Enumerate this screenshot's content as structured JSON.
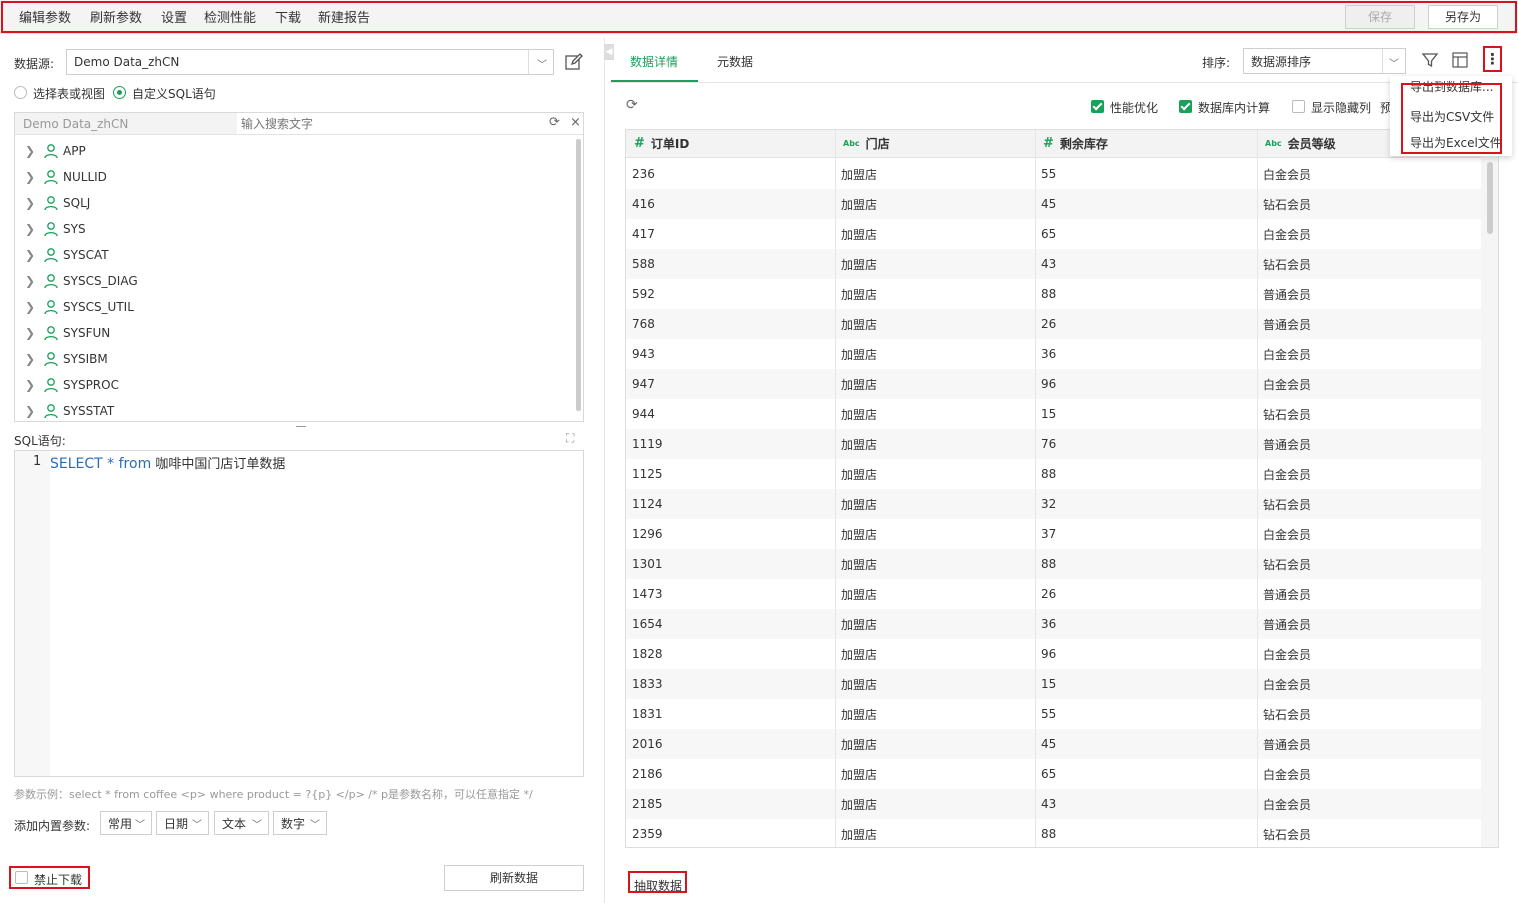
{
  "toolbar": {
    "menus": [
      "编辑参数",
      "刷新参数",
      "设置",
      "检测性能",
      "下载",
      "新建报告"
    ],
    "save_label": "保存",
    "saveas_label": "另存为"
  },
  "left": {
    "datasource_label": "数据源:",
    "datasource_value": "Demo Data_zhCN",
    "radio_table": "选择表或视图",
    "radio_sql": "自定义SQL语句",
    "tree_header": "Demo Data_zhCN",
    "search_placeholder": "输入搜索文字",
    "tree_items": [
      "APP",
      "NULLID",
      "SQLJ",
      "SYS",
      "SYSCAT",
      "SYSCS_DIAG",
      "SYSCS_UTIL",
      "SYSFUN",
      "SYSIBM",
      "SYSPROC",
      "SYSSTAT"
    ],
    "sql_label": "SQL语句:",
    "sql_line_no": "1",
    "sql_kw_select": "SELECT",
    "sql_star": " * ",
    "sql_kw_from": "from",
    "sql_table": " 咖啡中国门店订单数据",
    "param_hint": "参数示例：select * from coffee <p> where product = ?{p} </p> /* p是参数名称，可以任意指定 */",
    "add_param_label": "添加内置参数:",
    "param_dropdowns": [
      "常用",
      "日期",
      "文本",
      "数字"
    ],
    "disable_download": "禁止下载",
    "refresh_data": "刷新数据"
  },
  "right": {
    "tabs": [
      "数据详情",
      "元数据"
    ],
    "sort_label": "排序:",
    "sort_value": "数据源排序",
    "opt_perf": "性能优化",
    "opt_dbcalc": "数据库内计算",
    "opt_hidden": "显示隐藏列",
    "opt_preview": "预",
    "export_menu": [
      "导出到数据库...",
      "导出为CSV文件",
      "导出为Excel文件"
    ],
    "columns": [
      {
        "type": "#",
        "name": "订单ID"
      },
      {
        "type": "Abc",
        "name": "门店"
      },
      {
        "type": "#",
        "name": "剩余库存"
      },
      {
        "type": "Abc",
        "name": "会员等级"
      }
    ],
    "rows": [
      [
        "236",
        "加盟店",
        "55",
        "白金会员"
      ],
      [
        "416",
        "加盟店",
        "45",
        "钻石会员"
      ],
      [
        "417",
        "加盟店",
        "65",
        "白金会员"
      ],
      [
        "588",
        "加盟店",
        "43",
        "钻石会员"
      ],
      [
        "592",
        "加盟店",
        "88",
        "普通会员"
      ],
      [
        "768",
        "加盟店",
        "26",
        "普通会员"
      ],
      [
        "943",
        "加盟店",
        "36",
        "白金会员"
      ],
      [
        "947",
        "加盟店",
        "96",
        "白金会员"
      ],
      [
        "944",
        "加盟店",
        "15",
        "钻石会员"
      ],
      [
        "1119",
        "加盟店",
        "76",
        "普通会员"
      ],
      [
        "1125",
        "加盟店",
        "88",
        "白金会员"
      ],
      [
        "1124",
        "加盟店",
        "32",
        "钻石会员"
      ],
      [
        "1296",
        "加盟店",
        "37",
        "白金会员"
      ],
      [
        "1301",
        "加盟店",
        "88",
        "钻石会员"
      ],
      [
        "1473",
        "加盟店",
        "26",
        "普通会员"
      ],
      [
        "1654",
        "加盟店",
        "36",
        "普通会员"
      ],
      [
        "1828",
        "加盟店",
        "96",
        "白金会员"
      ],
      [
        "1833",
        "加盟店",
        "15",
        "白金会员"
      ],
      [
        "1831",
        "加盟店",
        "55",
        "钻石会员"
      ],
      [
        "2016",
        "加盟店",
        "45",
        "普通会员"
      ],
      [
        "2186",
        "加盟店",
        "65",
        "白金会员"
      ],
      [
        "2185",
        "加盟店",
        "43",
        "白金会员"
      ],
      [
        "2359",
        "加盟店",
        "88",
        "钻石会员"
      ]
    ],
    "extract_label": "抽取数据"
  },
  "colors": {
    "accent": "#1aa05a",
    "highlight": "#d8131b",
    "sql_keyword": "#2b6cb8"
  }
}
